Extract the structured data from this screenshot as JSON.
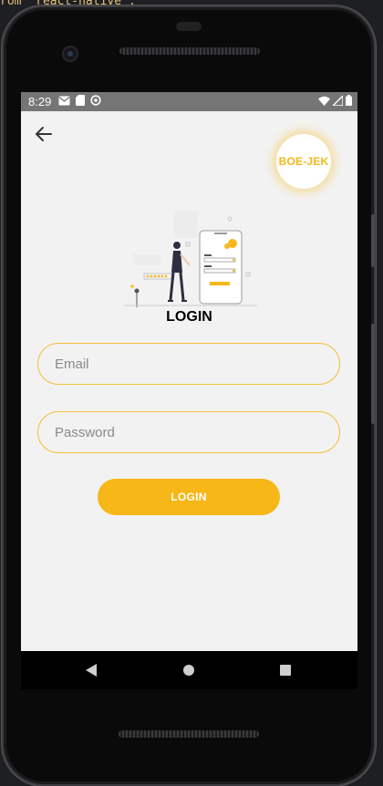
{
  "editor": {
    "code_line": "rom 'react-native';"
  },
  "status_bar": {
    "time": "8:29",
    "left_icons": [
      "gmail-icon",
      "sd-card-icon",
      "sync-icon"
    ],
    "right_icons": [
      "wifi-icon",
      "signal-icon",
      "battery-icon"
    ]
  },
  "header": {
    "back_icon": "arrow-left-icon",
    "logo_text": "BOE-JEK"
  },
  "main": {
    "title": "LOGIN",
    "email": {
      "placeholder": "Email",
      "value": ""
    },
    "password": {
      "placeholder": "Password",
      "value": ""
    },
    "login_button_label": "LOGIN"
  },
  "colors": {
    "accent": "#F7B718",
    "screen_background": "#F2F2F2",
    "status_bar": "#757575"
  },
  "nav_bar": {
    "icons": [
      "back-triangle-icon",
      "home-circle-icon",
      "recents-square-icon"
    ]
  }
}
